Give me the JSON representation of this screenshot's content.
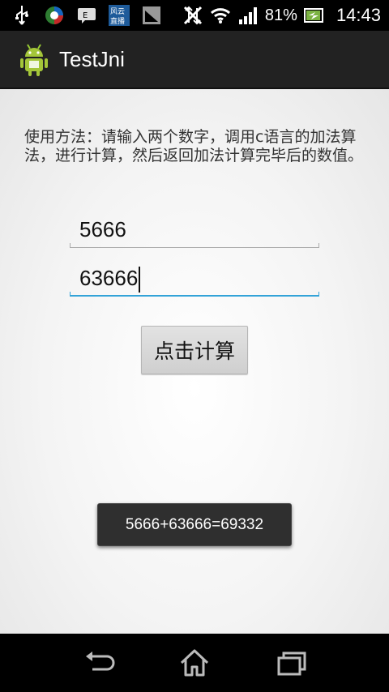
{
  "status_bar": {
    "icons": [
      "usb-icon",
      "app-circle-icon",
      "message-icon",
      "fengyun-app-icon",
      "signal-app-icon",
      "no-data-icon",
      "wifi-icon",
      "cell-signal-icon",
      "battery-charging-icon"
    ],
    "battery_label": "81%",
    "time": "14:43",
    "app_badge_text": "风云直播"
  },
  "action_bar": {
    "title": "TestJni",
    "icon": "android-icon"
  },
  "content": {
    "description": "使用方法：请输入两个数字，调用c语言的加法算法，进行计算，然后返回加法计算完毕后的数值。",
    "input1_value": "5666",
    "input2_value": "63666",
    "button_label": "点击计算"
  },
  "toast": {
    "message": "5666+63666=69332"
  },
  "nav_bar": {
    "buttons": [
      "back-icon",
      "home-icon",
      "recent-apps-icon"
    ]
  },
  "colors": {
    "focus_underline": "#33a3d8",
    "action_bar_bg": "#222222",
    "toast_bg": "#2f2f2f"
  }
}
